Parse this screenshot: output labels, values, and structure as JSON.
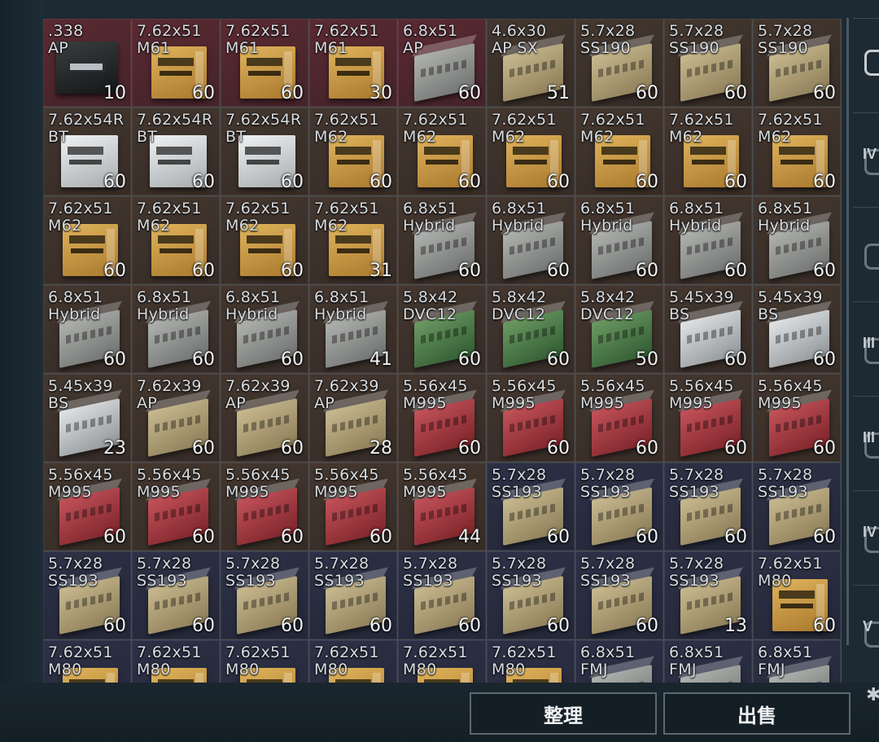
{
  "inventory": {
    "cells": [
      {
        "cal": ".338",
        "type": "AP",
        "qty": "10",
        "tint": "red",
        "icon": "box-dark"
      },
      {
        "cal": "7.62x51",
        "type": "M61",
        "qty": "60",
        "tint": "red",
        "icon": "box-gold"
      },
      {
        "cal": "7.62x51",
        "type": "M61",
        "qty": "60",
        "tint": "red",
        "icon": "box-gold"
      },
      {
        "cal": "7.62x51",
        "type": "M61",
        "qty": "30",
        "tint": "red",
        "icon": "box-gold"
      },
      {
        "cal": "6.8x51",
        "type": "AP",
        "qty": "60",
        "tint": "red",
        "icon": "box-std gray"
      },
      {
        "cal": "4.6x30",
        "type": "AP SX",
        "qty": "51",
        "tint": "brown",
        "icon": "box-std tan"
      },
      {
        "cal": "5.7x28",
        "type": "SS190",
        "qty": "60",
        "tint": "brown",
        "icon": "box-std tan"
      },
      {
        "cal": "5.7x28",
        "type": "SS190",
        "qty": "60",
        "tint": "brown",
        "icon": "box-std tan"
      },
      {
        "cal": "5.7x28",
        "type": "SS190",
        "qty": "60",
        "tint": "brown",
        "icon": "box-std tan"
      },
      {
        "cal": "7.62x54R",
        "type": "BT",
        "qty": "60",
        "tint": "brown",
        "icon": "box-white"
      },
      {
        "cal": "7.62x54R",
        "type": "BT",
        "qty": "60",
        "tint": "brown",
        "icon": "box-white"
      },
      {
        "cal": "7.62x54R",
        "type": "BT",
        "qty": "60",
        "tint": "brown",
        "icon": "box-white"
      },
      {
        "cal": "7.62x51",
        "type": "M62",
        "qty": "60",
        "tint": "brown",
        "icon": "box-gold"
      },
      {
        "cal": "7.62x51",
        "type": "M62",
        "qty": "60",
        "tint": "brown",
        "icon": "box-gold"
      },
      {
        "cal": "7.62x51",
        "type": "M62",
        "qty": "60",
        "tint": "brown",
        "icon": "box-gold"
      },
      {
        "cal": "7.62x51",
        "type": "M62",
        "qty": "60",
        "tint": "brown",
        "icon": "box-gold"
      },
      {
        "cal": "7.62x51",
        "type": "M62",
        "qty": "60",
        "tint": "brown",
        "icon": "box-gold"
      },
      {
        "cal": "7.62x51",
        "type": "M62",
        "qty": "60",
        "tint": "brown",
        "icon": "box-gold"
      },
      {
        "cal": "7.62x51",
        "type": "M62",
        "qty": "60",
        "tint": "brown",
        "icon": "box-gold"
      },
      {
        "cal": "7.62x51",
        "type": "M62",
        "qty": "60",
        "tint": "brown",
        "icon": "box-gold"
      },
      {
        "cal": "7.62x51",
        "type": "M62",
        "qty": "60",
        "tint": "brown",
        "icon": "box-gold"
      },
      {
        "cal": "7.62x51",
        "type": "M62",
        "qty": "31",
        "tint": "brown",
        "icon": "box-gold"
      },
      {
        "cal": "6.8x51",
        "type": "Hybrid",
        "qty": "60",
        "tint": "brown",
        "icon": "box-std gray"
      },
      {
        "cal": "6.8x51",
        "type": "Hybrid",
        "qty": "60",
        "tint": "brown",
        "icon": "box-std gray"
      },
      {
        "cal": "6.8x51",
        "type": "Hybrid",
        "qty": "60",
        "tint": "brown",
        "icon": "box-std gray"
      },
      {
        "cal": "6.8x51",
        "type": "Hybrid",
        "qty": "60",
        "tint": "brown",
        "icon": "box-std gray"
      },
      {
        "cal": "6.8x51",
        "type": "Hybrid",
        "qty": "60",
        "tint": "brown",
        "icon": "box-std gray"
      },
      {
        "cal": "6.8x51",
        "type": "Hybrid",
        "qty": "60",
        "tint": "brown",
        "icon": "box-std gray"
      },
      {
        "cal": "6.8x51",
        "type": "Hybrid",
        "qty": "60",
        "tint": "brown",
        "icon": "box-std gray"
      },
      {
        "cal": "6.8x51",
        "type": "Hybrid",
        "qty": "60",
        "tint": "brown",
        "icon": "box-std gray"
      },
      {
        "cal": "6.8x51",
        "type": "Hybrid",
        "qty": "41",
        "tint": "brown",
        "icon": "box-std gray"
      },
      {
        "cal": "5.8x42",
        "type": "DVC12",
        "qty": "60",
        "tint": "brown",
        "icon": "box-std green"
      },
      {
        "cal": "5.8x42",
        "type": "DVC12",
        "qty": "60",
        "tint": "brown",
        "icon": "box-std green"
      },
      {
        "cal": "5.8x42",
        "type": "DVC12",
        "qty": "50",
        "tint": "brown",
        "icon": "box-std green"
      },
      {
        "cal": "5.45x39",
        "type": "BS",
        "qty": "60",
        "tint": "brown",
        "icon": "box-std silver"
      },
      {
        "cal": "5.45x39",
        "type": "BS",
        "qty": "60",
        "tint": "brown",
        "icon": "box-std silver"
      },
      {
        "cal": "5.45x39",
        "type": "BS",
        "qty": "23",
        "tint": "brown",
        "icon": "box-std silver"
      },
      {
        "cal": "7.62x39",
        "type": "AP",
        "qty": "60",
        "tint": "brown",
        "icon": "box-std tan"
      },
      {
        "cal": "7.62x39",
        "type": "AP",
        "qty": "60",
        "tint": "brown",
        "icon": "box-std tan"
      },
      {
        "cal": "7.62x39",
        "type": "AP",
        "qty": "28",
        "tint": "brown",
        "icon": "box-std tan"
      },
      {
        "cal": "5.56x45",
        "type": "M995",
        "qty": "60",
        "tint": "brown",
        "icon": "box-std red"
      },
      {
        "cal": "5.56x45",
        "type": "M995",
        "qty": "60",
        "tint": "brown",
        "icon": "box-std red"
      },
      {
        "cal": "5.56x45",
        "type": "M995",
        "qty": "60",
        "tint": "brown",
        "icon": "box-std red"
      },
      {
        "cal": "5.56x45",
        "type": "M995",
        "qty": "60",
        "tint": "brown",
        "icon": "box-std red"
      },
      {
        "cal": "5.56x45",
        "type": "M995",
        "qty": "60",
        "tint": "brown",
        "icon": "box-std red"
      },
      {
        "cal": "5.56x45",
        "type": "M995",
        "qty": "60",
        "tint": "brown",
        "icon": "box-std red"
      },
      {
        "cal": "5.56x45",
        "type": "M995",
        "qty": "60",
        "tint": "brown",
        "icon": "box-std red"
      },
      {
        "cal": "5.56x45",
        "type": "M995",
        "qty": "60",
        "tint": "brown",
        "icon": "box-std red"
      },
      {
        "cal": "5.56x45",
        "type": "M995",
        "qty": "60",
        "tint": "brown",
        "icon": "box-std red"
      },
      {
        "cal": "5.56x45",
        "type": "M995",
        "qty": "44",
        "tint": "brown",
        "icon": "box-std red"
      },
      {
        "cal": "5.7x28",
        "type": "SS193",
        "qty": "60",
        "tint": "blue",
        "icon": "box-std tan"
      },
      {
        "cal": "5.7x28",
        "type": "SS193",
        "qty": "60",
        "tint": "blue",
        "icon": "box-std tan"
      },
      {
        "cal": "5.7x28",
        "type": "SS193",
        "qty": "60",
        "tint": "blue",
        "icon": "box-std tan"
      },
      {
        "cal": "5.7x28",
        "type": "SS193",
        "qty": "60",
        "tint": "blue",
        "icon": "box-std tan"
      },
      {
        "cal": "5.7x28",
        "type": "SS193",
        "qty": "60",
        "tint": "blue",
        "icon": "box-std tan"
      },
      {
        "cal": "5.7x28",
        "type": "SS193",
        "qty": "60",
        "tint": "blue",
        "icon": "box-std tan"
      },
      {
        "cal": "5.7x28",
        "type": "SS193",
        "qty": "60",
        "tint": "blue",
        "icon": "box-std tan"
      },
      {
        "cal": "5.7x28",
        "type": "SS193",
        "qty": "60",
        "tint": "blue",
        "icon": "box-std tan"
      },
      {
        "cal": "5.7x28",
        "type": "SS193",
        "qty": "60",
        "tint": "blue",
        "icon": "box-std tan"
      },
      {
        "cal": "5.7x28",
        "type": "SS193",
        "qty": "60",
        "tint": "blue",
        "icon": "box-std tan"
      },
      {
        "cal": "5.7x28",
        "type": "SS193",
        "qty": "60",
        "tint": "blue",
        "icon": "box-std tan"
      },
      {
        "cal": "5.7x28",
        "type": "SS193",
        "qty": "13",
        "tint": "blue",
        "icon": "box-std tan"
      },
      {
        "cal": "7.62x51",
        "type": "M80",
        "qty": "60",
        "tint": "blue",
        "icon": "box-gold"
      },
      {
        "cal": "7.62x51",
        "type": "M80",
        "qty": "",
        "tint": "blue",
        "icon": "box-gold"
      },
      {
        "cal": "7.62x51",
        "type": "M80",
        "qty": "",
        "tint": "blue",
        "icon": "box-gold"
      },
      {
        "cal": "7.62x51",
        "type": "M80",
        "qty": "",
        "tint": "blue",
        "icon": "box-gold"
      },
      {
        "cal": "7.62x51",
        "type": "M80",
        "qty": "",
        "tint": "blue",
        "icon": "box-gold"
      },
      {
        "cal": "7.62x51",
        "type": "M80",
        "qty": "",
        "tint": "blue",
        "icon": "box-gold"
      },
      {
        "cal": "7.62x51",
        "type": "M80",
        "qty": "",
        "tint": "blue",
        "icon": "box-gold"
      },
      {
        "cal": "6.8x51",
        "type": "FMJ",
        "qty": "",
        "tint": "blue",
        "icon": "box-std gray"
      },
      {
        "cal": "6.8x51",
        "type": "FMJ",
        "qty": "",
        "tint": "blue",
        "icon": "box-std gray"
      },
      {
        "cal": "6.8x51",
        "type": "FMJ",
        "qty": "",
        "tint": "blue",
        "icon": "box-std gray"
      }
    ]
  },
  "sidebar": {
    "tabs": [
      {
        "label": "",
        "icon": "backpack-icon"
      },
      {
        "label": "IV",
        "icon": "armor-icon"
      },
      {
        "label": "",
        "icon": "armor-icon"
      },
      {
        "label": "III",
        "icon": "armor-icon"
      },
      {
        "label": "III",
        "icon": "armor-icon"
      },
      {
        "label": "IV",
        "icon": "armor-icon"
      },
      {
        "label": "V",
        "icon": "armor-icon"
      }
    ]
  },
  "actions": {
    "sort_label": "整理",
    "sell_label": "出售"
  },
  "colors": {
    "tint_red": "#5a2a31",
    "tint_brown": "#43372f",
    "tint_blue": "#2d3146"
  },
  "icons": {
    "settings": "gear-icon"
  }
}
